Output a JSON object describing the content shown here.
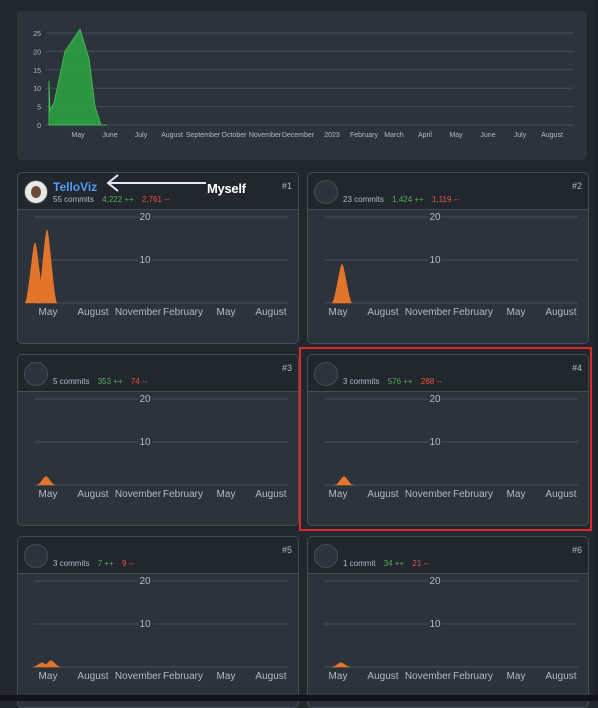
{
  "colors": {
    "overview_area": "#2ea043",
    "contributor_area": "#e3742b",
    "additions": "#57ab5a",
    "deletions": "#e5534b",
    "link": "#539bf5",
    "highlight_border": "#e0272a"
  },
  "chart_data": [
    {
      "type": "area",
      "x": [
        "Apr",
        "May",
        "June",
        "July",
        "August",
        "September",
        "October",
        "November",
        "December",
        "2023",
        "February",
        "March",
        "April",
        "May",
        "June",
        "July",
        "August"
      ],
      "x_tick_labels": [
        "May",
        "June",
        "July",
        "August",
        "September",
        "October",
        "November",
        "December",
        "2023",
        "February",
        "March",
        "April",
        "May",
        "June",
        "July",
        "August"
      ],
      "y_ticks": [
        0,
        5,
        10,
        15,
        20,
        25
      ],
      "ylim": [
        0,
        28
      ],
      "series": [
        {
          "color": "#2ea043",
          "values": [
            {
              "x": "Apr",
              "y": 12
            },
            {
              "x": "Apr",
              "y": 4
            },
            {
              "x": "Apr",
              "y": 6
            },
            {
              "x": "May",
              "y": 20
            },
            {
              "x": "May",
              "y": 26
            },
            {
              "x": "May",
              "y": 18
            },
            {
              "x": "May",
              "y": 5
            },
            {
              "x": "June",
              "y": 0
            },
            {
              "x": "August",
              "y": 0
            }
          ]
        }
      ],
      "grid": true
    }
  ],
  "x_axis_labels": [
    "May",
    "August",
    "November",
    "February",
    "May",
    "August"
  ],
  "y_axis_labels": [
    "20",
    "10"
  ],
  "contributors": [
    {
      "rank": "#1",
      "name": "TelloViz",
      "commits": "55 commits",
      "additions": "4,222 ++",
      "deletions": "2,761 --",
      "peaks": [
        {
          "x": "Apr",
          "y": 14
        },
        {
          "x": "May",
          "y": 17
        }
      ]
    },
    {
      "rank": "#2",
      "name": "",
      "commits": "23 commits",
      "additions": "1,424 ++",
      "deletions": "1,119 --",
      "peaks": [
        {
          "x": "May",
          "y": 9
        }
      ]
    },
    {
      "rank": "#3",
      "name": "",
      "commits": "5 commits",
      "additions": "353 ++",
      "deletions": "74 --",
      "peaks": [
        {
          "x": "May",
          "y": 2
        }
      ]
    },
    {
      "rank": "#4",
      "name": "",
      "commits": "3 commits",
      "additions": "576 ++",
      "deletions": "288 --",
      "peaks": [
        {
          "x": "May",
          "y": 2
        }
      ]
    },
    {
      "rank": "#5",
      "name": "",
      "commits": "3 commits",
      "additions": "7 ++",
      "deletions": "9 --",
      "peaks": [
        {
          "x": "May",
          "y": 1
        },
        {
          "x": "May",
          "y": 1.5
        }
      ]
    },
    {
      "rank": "#6",
      "name": "",
      "commits": "1 commit",
      "additions": "34 ++",
      "deletions": "21 --",
      "peaks": [
        {
          "x": "May",
          "y": 1
        }
      ]
    }
  ],
  "annotation": {
    "label": "Myself"
  }
}
